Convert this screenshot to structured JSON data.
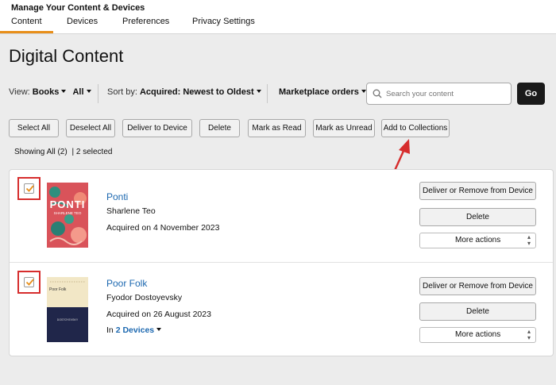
{
  "header": {
    "title": "Manage Your Content & Devices",
    "tabs": [
      {
        "label": "Content"
      },
      {
        "label": "Devices"
      },
      {
        "label": "Preferences"
      },
      {
        "label": "Privacy Settings"
      }
    ]
  },
  "page_title": "Digital Content",
  "filters": {
    "view_label": "View:",
    "view_value": "Books",
    "view_scope": "All",
    "sort_label": "Sort by:",
    "sort_value": "Acquired: Newest to Oldest",
    "marketplace": "Marketplace orders"
  },
  "search": {
    "placeholder": "Search your content",
    "go_label": "Go"
  },
  "actions": {
    "select_all": "Select All",
    "deselect_all": "Deselect All",
    "deliver": "Deliver to Device",
    "delete": "Delete",
    "mark_read": "Mark as Read",
    "mark_unread": "Mark as Unread",
    "add_collections": "Add to Collections"
  },
  "status": {
    "showing": "Showing All (2)",
    "selected": "| 2 selected"
  },
  "items": [
    {
      "title": "Ponti",
      "author": "Sharlene Teo",
      "acquired": "Acquired on 4 November 2023",
      "cover_text": "PONTI",
      "cover_sub": "SHARLENE TEO",
      "checked": true
    },
    {
      "title": "Poor Folk",
      "author": "Fyodor Dostoyevsky",
      "acquired": "Acquired on 26 August 2023",
      "devices_prefix": "In",
      "devices_link": "2 Devices",
      "cover_text": "Poor Folk",
      "cover_sub": "DOSTOYEVSKY",
      "checked": true
    }
  ],
  "row_buttons": {
    "deliver_remove": "Deliver or Remove from Device",
    "delete": "Delete",
    "more_actions": "More actions"
  },
  "colors": {
    "accent_tab": "#e88f1a",
    "link": "#1c68b0",
    "annotation": "#d62d2d",
    "go_button": "#1a1a1a"
  }
}
